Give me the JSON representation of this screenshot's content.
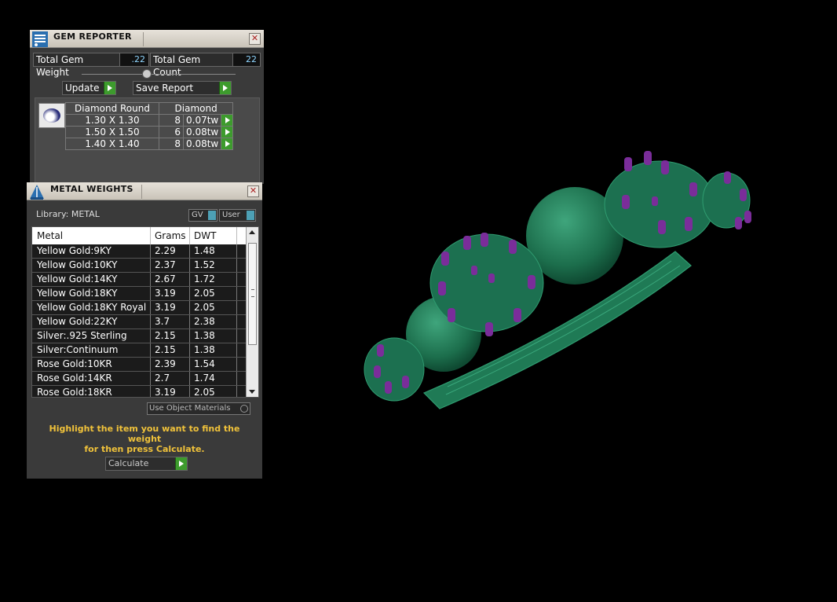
{
  "gem_reporter": {
    "title": "GEM REPORTER",
    "close": "✕",
    "total_weight_label": "Total Gem Weight",
    "total_weight_value": ".22",
    "total_count_label": "Total Gem Count",
    "total_count_value": "22",
    "update_label": "Update",
    "save_label": "Save Report",
    "table": {
      "shape_header": "Diamond Round",
      "type_header": "Diamond",
      "rows": [
        {
          "size": "1.30 X 1.30",
          "count": "8",
          "weight": "0.07tw"
        },
        {
          "size": "1.50 X 1.50",
          "count": "6",
          "weight": "0.08tw"
        },
        {
          "size": "1.40 X 1.40",
          "count": "8",
          "weight": "0.08tw"
        }
      ]
    }
  },
  "metal_weights": {
    "title": "METAL WEIGHTS",
    "close": "✕",
    "library": "Library: METAL",
    "gv_label": "GV",
    "user_label": "User",
    "headers": {
      "metal": "Metal",
      "grams": "Grams",
      "dwt": "DWT"
    },
    "rows": [
      {
        "metal": "Yellow Gold:9KY",
        "grams": "2.29",
        "dwt": "1.48"
      },
      {
        "metal": "Yellow Gold:10KY",
        "grams": "2.37",
        "dwt": "1.52"
      },
      {
        "metal": "Yellow Gold:14KY",
        "grams": "2.67",
        "dwt": "1.72"
      },
      {
        "metal": "Yellow Gold:18KY",
        "grams": "3.19",
        "dwt": "2.05"
      },
      {
        "metal": "Yellow Gold:18KY Royal",
        "grams": "3.19",
        "dwt": "2.05"
      },
      {
        "metal": "Yellow Gold:22KY",
        "grams": "3.7",
        "dwt": "2.38"
      },
      {
        "metal": "Silver:.925 Sterling",
        "grams": "2.15",
        "dwt": "1.38"
      },
      {
        "metal": "Silver:Continuum",
        "grams": "2.15",
        "dwt": "1.38"
      },
      {
        "metal": "Rose Gold:10KR",
        "grams": "2.39",
        "dwt": "1.54"
      },
      {
        "metal": "Rose Gold:14KR",
        "grams": "2.7",
        "dwt": "1.74"
      },
      {
        "metal": "Rose Gold:18KR",
        "grams": "3.19",
        "dwt": "2.05"
      }
    ],
    "use_object_materials": "Use Object Materials",
    "hint_line1": "Highlight the item you want to find the weight",
    "hint_line2": "for then press Calculate.",
    "calculate_label": "Calculate"
  },
  "colors": {
    "ring_metal": "#1f7a55",
    "gem_blue": "#8cc8f0",
    "prong_purple": "#7a2d9a",
    "hint_yellow": "#f0c23a",
    "go_green": "#3d9b2d"
  }
}
